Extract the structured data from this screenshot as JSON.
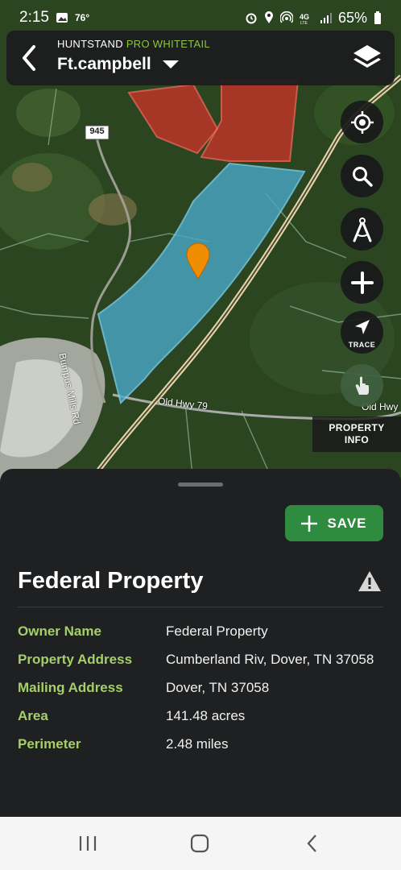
{
  "status": {
    "time": "2:15",
    "temp": "76°",
    "battery": "65%"
  },
  "header": {
    "app_name": "HUNTSTAND",
    "app_tier": "PRO WHITETAIL",
    "location": "Ft.campbell"
  },
  "map": {
    "road_label_945": "945",
    "road_bumpus": "Bumpus Mills Rd",
    "road_hwy79": "Old Hwy 79",
    "road_hwy79_b": "Old Hwy"
  },
  "fabs": {
    "trace_label": "TRACE",
    "property_info_label": "PROPERTY\nINFO"
  },
  "sheet": {
    "save_label": "SAVE",
    "title": "Federal Property",
    "fields": [
      {
        "key": "Owner Name",
        "value": "Federal Property"
      },
      {
        "key": "Property Address",
        "value": "Cumberland Riv, Dover, TN  37058"
      },
      {
        "key": "Mailing Address",
        "value": "Dover, TN  37058"
      },
      {
        "key": "Area",
        "value": "141.48 acres"
      },
      {
        "key": "Perimeter",
        "value": "2.48 miles"
      }
    ]
  },
  "colors": {
    "accent_green": "#2e8b3f",
    "label_green": "#a6cf6b",
    "parcel_red": "#d6332a",
    "parcel_blue": "#4aa8c8",
    "pin": "#f08c00"
  }
}
